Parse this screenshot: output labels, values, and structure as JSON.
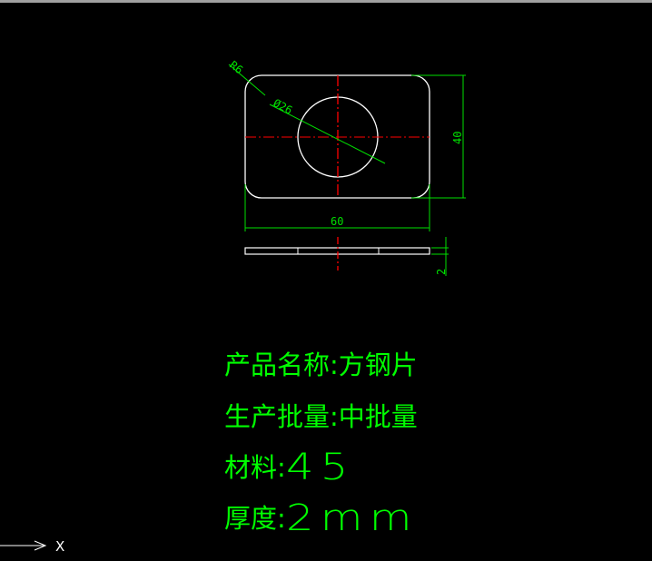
{
  "drawing": {
    "dimensions": {
      "radius": "R6",
      "diameter": "Ø26",
      "width": "60",
      "height": "40",
      "thickness": "2"
    },
    "colors": {
      "outline": "#ffffff",
      "dimension": "#00e000",
      "centerline": "#ff0000",
      "text": "#00ff00",
      "background": "#000000"
    }
  },
  "info": {
    "product_name_label": "产品名称:",
    "product_name_value": "方钢片",
    "batch_label": "生产批量:",
    "batch_value": "中批量",
    "material_label": "材料:",
    "material_value": "45",
    "thickness_label": "厚度:",
    "thickness_value": "2mm"
  },
  "ucs": {
    "axis_label": "X"
  }
}
